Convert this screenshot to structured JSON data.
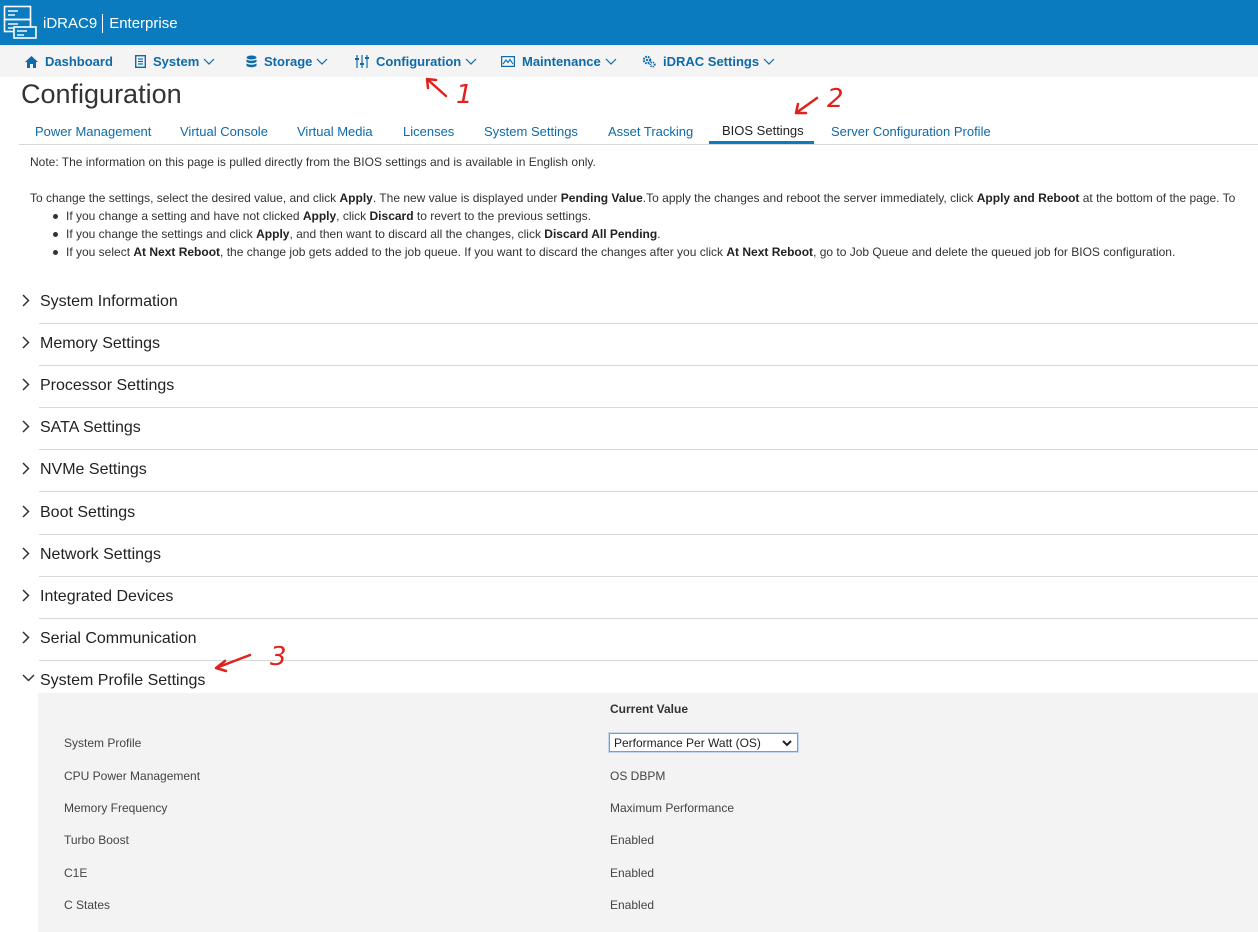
{
  "header": {
    "product": "iDRAC9",
    "edition": "Enterprise"
  },
  "nav": {
    "dashboard": "Dashboard",
    "system": "System",
    "storage": "Storage",
    "configuration": "Configuration",
    "maintenance": "Maintenance",
    "idrac_settings": "iDRAC Settings"
  },
  "page": {
    "title": "Configuration"
  },
  "tabs": [
    {
      "label": "Power Management"
    },
    {
      "label": "Virtual Console"
    },
    {
      "label": "Virtual Media"
    },
    {
      "label": "Licenses"
    },
    {
      "label": "System Settings"
    },
    {
      "label": "Asset Tracking"
    },
    {
      "label": "BIOS Settings",
      "active": true
    },
    {
      "label": "Server Configuration Profile"
    }
  ],
  "info": {
    "note": "Note: The information on this page is pulled directly from the BIOS settings and is available in English only.",
    "instr_1": "To change the settings, select the desired value, and click ",
    "instr_apply": "Apply",
    "instr_2": ". The new value is displayed under ",
    "instr_pending": "Pending Value",
    "instr_3": ".To apply the changes and reboot the server immediately, click ",
    "instr_apply_reboot": "Apply and Reboot",
    "instr_4": " at the bottom of the page. To",
    "b1_1": "If you change a setting and have not clicked ",
    "b1_apply": "Apply",
    "b1_2": ", click ",
    "b1_discard": "Discard",
    "b1_3": " to revert to the previous settings.",
    "b2_1": "If you change the settings and click ",
    "b2_apply": "Apply",
    "b2_2": ", and then want to discard all the changes, click ",
    "b2_discard_all": "Discard All Pending",
    "b2_3": ".",
    "b3_1": "If you select ",
    "b3_next": "At Next Reboot",
    "b3_2": ", the change job gets added to the job queue. If you want to discard the changes after you click ",
    "b3_next2": "At Next Reboot",
    "b3_3": ", go to Job Queue and delete the queued job for BIOS configuration."
  },
  "sections": [
    {
      "label": "System Information"
    },
    {
      "label": "Memory Settings"
    },
    {
      "label": "Processor Settings"
    },
    {
      "label": "SATA Settings"
    },
    {
      "label": "NVMe Settings"
    },
    {
      "label": "Boot Settings"
    },
    {
      "label": "Network Settings"
    },
    {
      "label": "Integrated Devices"
    },
    {
      "label": "Serial Communication"
    },
    {
      "label": "System Profile Settings",
      "expanded": true
    }
  ],
  "profile": {
    "column_header": "Current Value",
    "rows": [
      {
        "label": "System Profile",
        "value": "Performance Per Watt (OS)"
      },
      {
        "label": "CPU Power Management",
        "value": "OS DBPM"
      },
      {
        "label": "Memory Frequency",
        "value": "Maximum Performance"
      },
      {
        "label": "Turbo Boost",
        "value": "Enabled"
      },
      {
        "label": "C1E",
        "value": "Enabled"
      },
      {
        "label": "C States",
        "value": "Enabled"
      }
    ]
  },
  "annotations": {
    "one": "1",
    "two": "2",
    "three": "3",
    "color": "#e0211d"
  },
  "colors": {
    "brand": "#0a7bbf",
    "link": "#0e6aa8"
  }
}
